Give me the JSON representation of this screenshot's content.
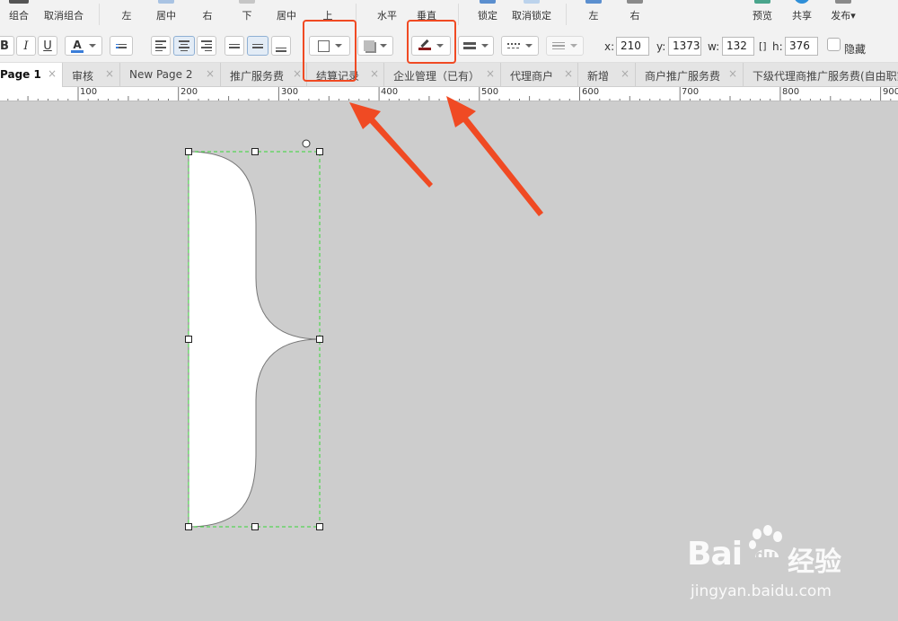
{
  "toolbar_top": {
    "items": [
      {
        "label": "组合",
        "icon": "group-icon"
      },
      {
        "label": "取消组合",
        "icon": "ungroup-icon"
      },
      {
        "label": "左",
        "icon": "align-left-icon"
      },
      {
        "label": "居中",
        "icon": "align-center-icon"
      },
      {
        "label": "右",
        "icon": "align-right-icon"
      },
      {
        "label": "下",
        "icon": "align-bottom-icon"
      },
      {
        "label": "居中",
        "icon": "align-middle-icon"
      },
      {
        "label": "上",
        "icon": "align-top-icon"
      },
      {
        "label": "水平",
        "icon": "distribute-horizontal-icon"
      },
      {
        "label": "垂直",
        "icon": "distribute-vertical-icon"
      },
      {
        "label": "锁定",
        "icon": "lock-icon"
      },
      {
        "label": "取消锁定",
        "icon": "unlock-icon"
      },
      {
        "label": "左",
        "icon": "left-icon"
      },
      {
        "label": "右",
        "icon": "right-icon"
      },
      {
        "label": "预览",
        "icon": "preview-icon"
      },
      {
        "label": "共享",
        "icon": "share-icon"
      },
      {
        "label": "发布▾",
        "icon": "publish-icon"
      }
    ]
  },
  "format_bar": {
    "bold": "B",
    "italic": "I",
    "underline": "U",
    "font_color_glyph": "A",
    "x_label": "x:",
    "x_value": "210",
    "y_label": "y:",
    "y_value": "1373",
    "w_label": "w:",
    "w_value": "132",
    "h_label": "h:",
    "h_value": "376",
    "hide_label": "隐藏",
    "accent_color": "#3b7dd8",
    "line_color": "#8b1a1a"
  },
  "tabs": [
    {
      "label": "Page 1",
      "active": true
    },
    {
      "label": "审核"
    },
    {
      "label": "New Page 2"
    },
    {
      "label": "推广服务费"
    },
    {
      "label": "结算记录"
    },
    {
      "label": "企业管理（已有）"
    },
    {
      "label": "代理商户"
    },
    {
      "label": "新增"
    },
    {
      "label": "商户推广服务费"
    },
    {
      "label": "下级代理商推广服务费(自由职家)"
    }
  ],
  "tab_close_glyph": "×",
  "ruler": {
    "labels": [
      "100",
      "200",
      "300",
      "400",
      "500",
      "600",
      "700",
      "800",
      "900"
    ]
  },
  "canvas": {
    "shape": "right-curly-brace",
    "fill": "#ffffff",
    "stroke": "#777777",
    "selection_color": "#37d637"
  },
  "watermark": {
    "brand": "Bai",
    "brand_du": "du",
    "suffix": "经验",
    "url": "jingyan.baidu.com"
  },
  "highlight_color": "#f04a23"
}
